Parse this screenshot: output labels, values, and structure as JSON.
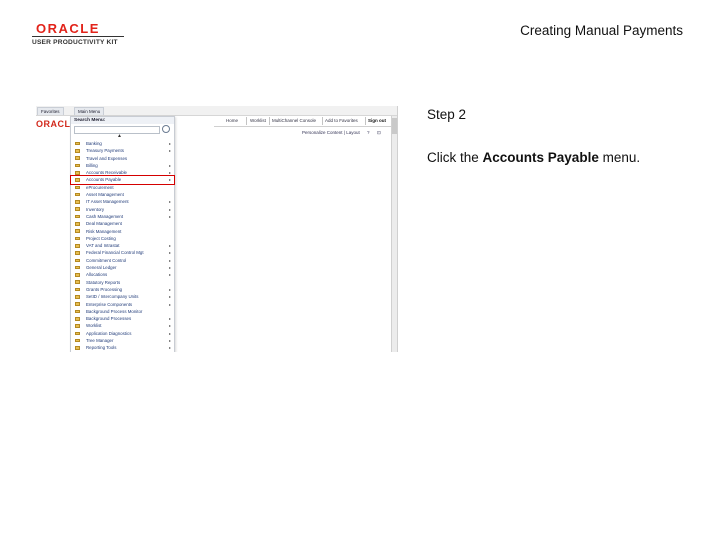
{
  "header": {
    "logo_brand": "ORACLE",
    "logo_sub": "USER PRODUCTIVITY KIT",
    "title": "Creating Manual Payments"
  },
  "step": {
    "label": "Step 2",
    "instruction_prefix": "Click the ",
    "instruction_target": "Accounts Payable",
    "instruction_suffix": " menu."
  },
  "screenshot": {
    "top_tabs": [
      "Favorites",
      "Main Menu"
    ],
    "brand": "ORACLE",
    "nav": [
      "Home",
      "Worklist",
      "MultiChannel Console",
      "Add to Favorites",
      "Sign out"
    ],
    "personalize": "Personalize Content | Layout",
    "tool_icons": [
      "?",
      "⊡"
    ],
    "menu": {
      "header": "Search Menu:",
      "caret": "▲",
      "items": [
        {
          "label": "Banking",
          "chevron": "▸"
        },
        {
          "label": "Treasury Payments",
          "chevron": "▸"
        },
        {
          "label": "Travel and Expenses",
          "chevron": ""
        },
        {
          "label": "Billing",
          "chevron": "▸"
        },
        {
          "label": "Accounts Receivable",
          "chevron": "▸"
        },
        {
          "label": "Accounts Payable",
          "chevron": "▸",
          "highlight": true
        },
        {
          "label": "eProcurement",
          "chevron": ""
        },
        {
          "label": "Asset Management",
          "chevron": ""
        },
        {
          "label": "IT Asset Management",
          "chevron": "▸"
        },
        {
          "label": "Inventory",
          "chevron": "▸"
        },
        {
          "label": "Cash Management",
          "chevron": "▸"
        },
        {
          "label": "Deal Management",
          "chevron": ""
        },
        {
          "label": "Risk Management",
          "chevron": ""
        },
        {
          "label": "Project Costing",
          "chevron": ""
        },
        {
          "label": "VAT and Intrastat",
          "chevron": "▸"
        },
        {
          "label": "Federal Financial Control Mgt",
          "chevron": "▸"
        },
        {
          "label": "Commitment Control",
          "chevron": "▸"
        },
        {
          "label": "General Ledger",
          "chevron": "▸"
        },
        {
          "label": "Allocations",
          "chevron": "▸"
        },
        {
          "label": "Statutory Reports",
          "chevron": ""
        },
        {
          "label": "Grants Processing",
          "chevron": "▸"
        },
        {
          "label": "SetID / Intercompany Units",
          "chevron": "▸"
        },
        {
          "label": "Enterprise Components",
          "chevron": "▸"
        },
        {
          "label": "Background Process Monitor",
          "chevron": ""
        },
        {
          "label": "Background Processes",
          "chevron": "▸"
        },
        {
          "label": "Worklist",
          "chevron": "▸"
        },
        {
          "label": "Application Diagnostics",
          "chevron": "▸"
        },
        {
          "label": "Tree Manager",
          "chevron": "▸"
        },
        {
          "label": "Reporting Tools",
          "chevron": "▸"
        }
      ]
    }
  },
  "colors": {
    "highlight": "#d40000",
    "oracle_red": "#e2231a",
    "menu_link": "#1f3a78"
  }
}
